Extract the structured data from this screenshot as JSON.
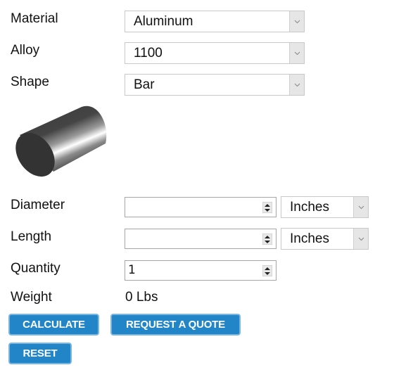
{
  "form": {
    "material": {
      "label": "Material",
      "value": "Aluminum"
    },
    "alloy": {
      "label": "Alloy",
      "value": "1100"
    },
    "shape": {
      "label": "Shape",
      "value": "Bar",
      "image_icon": "cylinder-bar-icon"
    },
    "diameter": {
      "label": "Diameter",
      "value": "",
      "unit": "Inches"
    },
    "length": {
      "label": "Length",
      "value": "",
      "unit": "Inches"
    },
    "quantity": {
      "label": "Quantity",
      "value": "1"
    },
    "weight": {
      "label": "Weight",
      "value": "0 Lbs"
    }
  },
  "buttons": {
    "calculate": "CALCULATE",
    "quote": "REQUEST A QUOTE",
    "reset": "RESET"
  },
  "colors": {
    "button_bg": "#2185c8",
    "button_border": "#7ab6e0"
  }
}
